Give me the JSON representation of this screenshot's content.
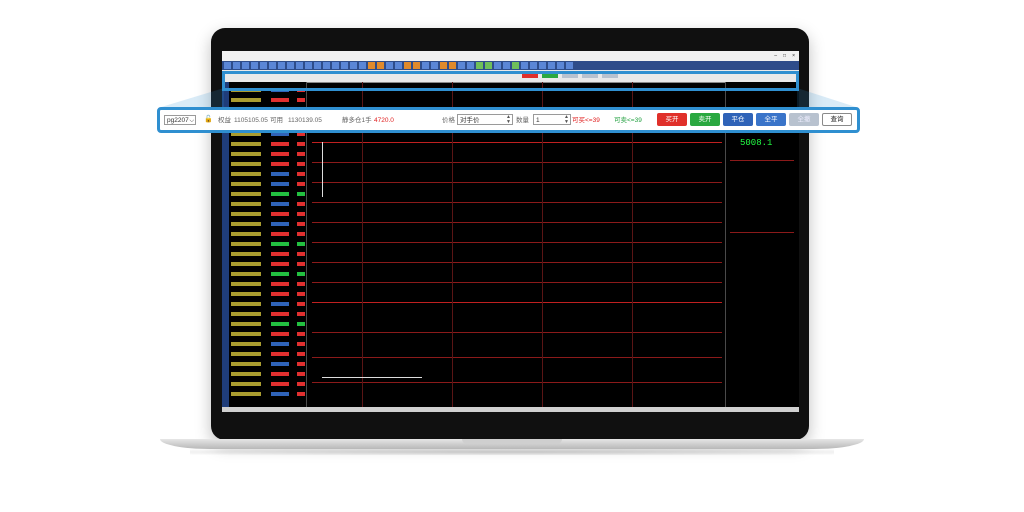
{
  "trade_panel": {
    "contract": "pg2207",
    "equity_label": "权益",
    "equity_value": "1105105.05",
    "available_label": "可用",
    "available_value": "1130139.05",
    "net_position_label": "静多仓1手",
    "net_position_value": "4720.0",
    "price_label": "价格",
    "price_type": "对手价",
    "qty_label": "数量",
    "qty_value": "1",
    "can_buy": "可买<=39",
    "can_sell": "可卖<=39",
    "buttons": {
      "buy_open": "买开",
      "sell_open": "卖开",
      "close": "平仓",
      "close_all": "全平",
      "cancel_all": "全撤",
      "query": "查询"
    }
  },
  "screen": {
    "last_price": "5008.1"
  },
  "colors": {
    "accent": "#2f8fd0",
    "buy": "#e0302a",
    "sell": "#2aa840",
    "close": "#2f63b8"
  }
}
